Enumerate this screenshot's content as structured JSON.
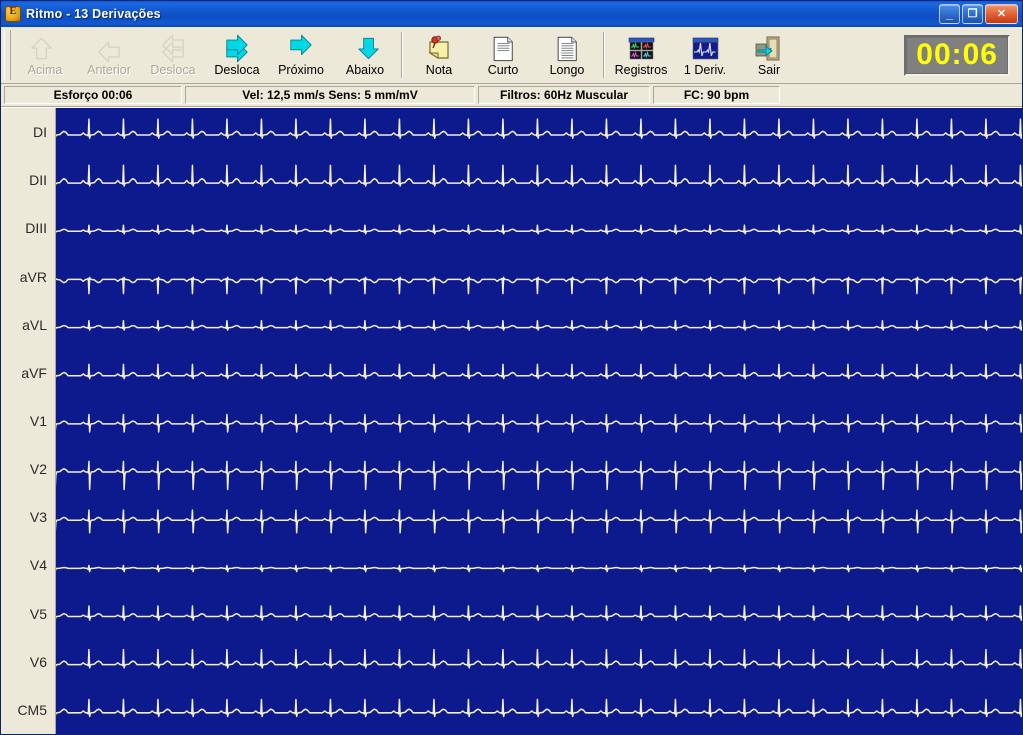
{
  "window": {
    "title": "Ritmo - 13 Derivações",
    "icon": "ecg-app-icon",
    "minimize_label": "_",
    "restore_label": "❐",
    "close_label": "✕"
  },
  "toolbar": {
    "buttons": [
      {
        "id": "acima",
        "label": "Acima",
        "icon": "arrow-up-icon",
        "enabled": false
      },
      {
        "id": "anterior",
        "label": "Anterior",
        "icon": "arrow-left-icon",
        "enabled": false
      },
      {
        "id": "desloca-prev",
        "label": "Desloca",
        "icon": "arrow-double-left-icon",
        "enabled": false
      },
      {
        "id": "desloca-next",
        "label": "Desloca",
        "icon": "arrow-double-right-icon",
        "enabled": true
      },
      {
        "id": "proximo",
        "label": "Próximo",
        "icon": "arrow-right-icon",
        "enabled": true
      },
      {
        "id": "abaixo",
        "label": "Abaixo",
        "icon": "arrow-down-icon",
        "enabled": true
      },
      {
        "id": "nota",
        "label": "Nota",
        "icon": "sticky-note-icon",
        "enabled": true
      },
      {
        "id": "curto",
        "label": "Curto",
        "icon": "document-short-icon",
        "enabled": true
      },
      {
        "id": "longo",
        "label": "Longo",
        "icon": "document-long-icon",
        "enabled": true
      },
      {
        "id": "registros",
        "label": "Registros",
        "icon": "records-grid-icon",
        "enabled": true
      },
      {
        "id": "1deriv",
        "label": "1 Deriv.",
        "icon": "single-lead-icon",
        "enabled": true
      },
      {
        "id": "sair",
        "label": "Sair",
        "icon": "exit-door-icon",
        "enabled": true
      }
    ],
    "separator_after": [
      "abaixo",
      "longo"
    ],
    "timer": "00:06"
  },
  "statusbar": {
    "effort": "Esforço 00:06",
    "speed_sens": "Vel: 12,5 mm/s Sens: 5 mm/mV",
    "filters": "Filtros: 60Hz Muscular",
    "heart_rate": "FC: 90 bpm"
  },
  "colors": {
    "trace": "#f2efcf",
    "trace_background": "#0d1a8e",
    "timer_text": "#ffff00",
    "timer_background": "#808080",
    "titlebar": "#0d52c8",
    "toolbar_background": "#ece9d8",
    "arrow_enabled": "#00d8e8",
    "arrow_disabled": "#d8d4c2"
  },
  "chart_data": {
    "type": "line",
    "title": "Ritmo - 13 Derivações",
    "xlabel": "",
    "ylabel": "",
    "sweep_speed": "12,5 mm/s",
    "sensitivity": "5 mm/mV",
    "heart_rate_bpm": 90,
    "elapsed_time": "00:06",
    "filters": "60Hz Muscular",
    "beats_per_strip": 28,
    "grid": false,
    "legend": "left-lead-labels",
    "lead_names": [
      "DI",
      "DII",
      "DIII",
      "aVR",
      "aVL",
      "aVF",
      "V1",
      "V2",
      "V3",
      "V4",
      "V5",
      "V6",
      "CM5"
    ],
    "series": [
      {
        "name": "DI",
        "p": 0.1,
        "q": -0.05,
        "r": 0.78,
        "s": -0.16,
        "t": 0.18
      },
      {
        "name": "DII",
        "p": 0.13,
        "q": -0.05,
        "r": 0.88,
        "s": -0.14,
        "t": 0.22
      },
      {
        "name": "DIII",
        "p": 0.06,
        "q": -0.04,
        "r": 0.3,
        "s": -0.12,
        "t": 0.1
      },
      {
        "name": "aVR",
        "p": -0.09,
        "q": 0.05,
        "r": -0.7,
        "s": 0.1,
        "t": -0.16
      },
      {
        "name": "aVL",
        "p": 0.06,
        "q": -0.04,
        "r": 0.34,
        "s": -0.12,
        "t": 0.1
      },
      {
        "name": "aVF",
        "p": 0.09,
        "q": -0.05,
        "r": 0.56,
        "s": -0.14,
        "t": 0.16
      },
      {
        "name": "V1",
        "p": 0.08,
        "q": -0.05,
        "r": 0.46,
        "s": -0.4,
        "t": 0.14
      },
      {
        "name": "V2",
        "p": 0.08,
        "q": -0.04,
        "r": 0.52,
        "s": -0.86,
        "t": 0.16
      },
      {
        "name": "V3",
        "p": 0.07,
        "q": -0.04,
        "r": 0.5,
        "s": -0.62,
        "t": 0.14
      },
      {
        "name": "V4",
        "p": 0.03,
        "q": -0.06,
        "r": 0.14,
        "s": -0.16,
        "t": 0.04
      },
      {
        "name": "V5",
        "p": 0.07,
        "q": -0.05,
        "r": 0.52,
        "s": -0.18,
        "t": 0.14
      },
      {
        "name": "V6",
        "p": 0.09,
        "q": -0.05,
        "r": 0.74,
        "s": -0.16,
        "t": 0.18
      },
      {
        "name": "CM5",
        "p": 0.09,
        "q": -0.05,
        "r": 0.66,
        "s": -0.18,
        "t": 0.18
      }
    ]
  }
}
